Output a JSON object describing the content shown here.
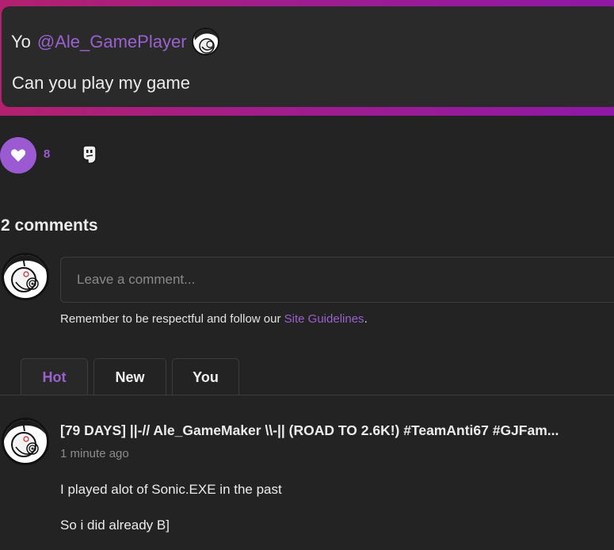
{
  "post": {
    "greeting": "Yo",
    "mention": "@Ale_GamePlayer",
    "body": "Can you play my game"
  },
  "actions": {
    "like_icon": "heart-icon",
    "like_count": "8",
    "secondary_icon": "ghost-icon"
  },
  "comments": {
    "heading": "2 comments",
    "input_placeholder": "Leave a comment...",
    "guidelines_prefix": "Remember to be respectful and follow our ",
    "guidelines_link": "Site Guidelines",
    "guidelines_suffix": ".",
    "tabs": [
      {
        "label": "Hot",
        "active": true
      },
      {
        "label": "New",
        "active": false
      },
      {
        "label": "You",
        "active": false
      }
    ],
    "items": [
      {
        "author": "[79 DAYS] ||-// Ale_GameMaker \\\\-|| (ROAD TO 2.6K!) #TeamAnti67 #GJFam...",
        "time": "1 minute ago",
        "paragraphs": [
          "I played alot of Sonic.EXE in the past",
          "So i did already B]"
        ]
      }
    ]
  },
  "colors": {
    "accent": "#9b5ad1",
    "background": "#232323",
    "banner_gradient_start": "#b3206e",
    "banner_gradient_end": "#8f18a6"
  }
}
